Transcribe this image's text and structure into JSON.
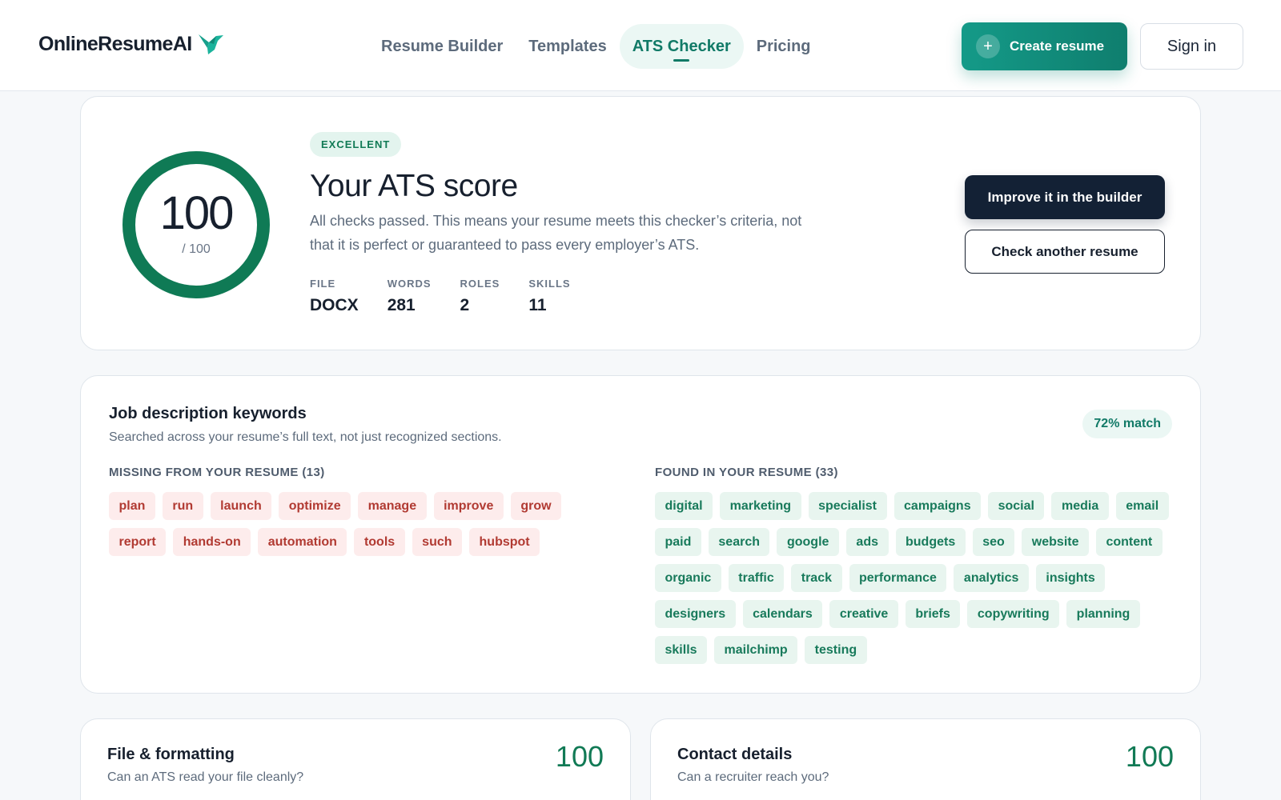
{
  "header": {
    "logo_text": "OnlineResumeAI",
    "logo_icon": "bird-icon",
    "nav": [
      {
        "label": "Resume Builder",
        "active": false
      },
      {
        "label": "Templates",
        "active": false
      },
      {
        "label": "ATS Checker",
        "active": true
      },
      {
        "label": "Pricing",
        "active": false
      }
    ],
    "create_label": "Create resume",
    "signin_label": "Sign in"
  },
  "score": {
    "value": "100",
    "denominator": "/ 100",
    "fill_fraction": 1.0,
    "badge": "EXCELLENT",
    "title": "Your ATS score",
    "description": "All checks passed. This means your resume meets this checker’s criteria, not that it is perfect or guaranteed to pass every employer’s ATS.",
    "stats": [
      {
        "label": "FILE",
        "value": "DOCX"
      },
      {
        "label": "WORDS",
        "value": "281"
      },
      {
        "label": "ROLES",
        "value": "2"
      },
      {
        "label": "SKILLS",
        "value": "11"
      }
    ],
    "improve_label": "Improve it in the builder",
    "check_label": "Check another resume"
  },
  "keywords": {
    "title": "Job description keywords",
    "subtitle": "Searched across your resume’s full text, not just recognized sections.",
    "match": "72% match",
    "missing_title": "MISSING FROM YOUR RESUME (13)",
    "missing": [
      "plan",
      "run",
      "launch",
      "optimize",
      "manage",
      "improve",
      "grow",
      "report",
      "hands-on",
      "automation",
      "tools",
      "such",
      "hubspot"
    ],
    "found_title": "FOUND IN YOUR RESUME (33)",
    "found": [
      "digital",
      "marketing",
      "specialist",
      "campaigns",
      "social",
      "media",
      "email",
      "paid",
      "search",
      "google",
      "ads",
      "budgets",
      "seo",
      "website",
      "content",
      "organic",
      "traffic",
      "track",
      "performance",
      "analytics",
      "insights",
      "designers",
      "calendars",
      "creative",
      "briefs",
      "copywriting",
      "planning",
      "skills",
      "mailchimp",
      "testing"
    ]
  },
  "sections": [
    {
      "title": "File & formatting",
      "subtitle": "Can an ATS read your file cleanly?",
      "score": "100"
    },
    {
      "title": "Contact details",
      "subtitle": "Can a recruiter reach you?",
      "score": "100"
    }
  ],
  "colors": {
    "brand": "#117a67",
    "score_green": "#0f7a55",
    "dark_button": "#132135",
    "missing_chip": "#fdecec",
    "found_chip": "#e8f5ef"
  }
}
